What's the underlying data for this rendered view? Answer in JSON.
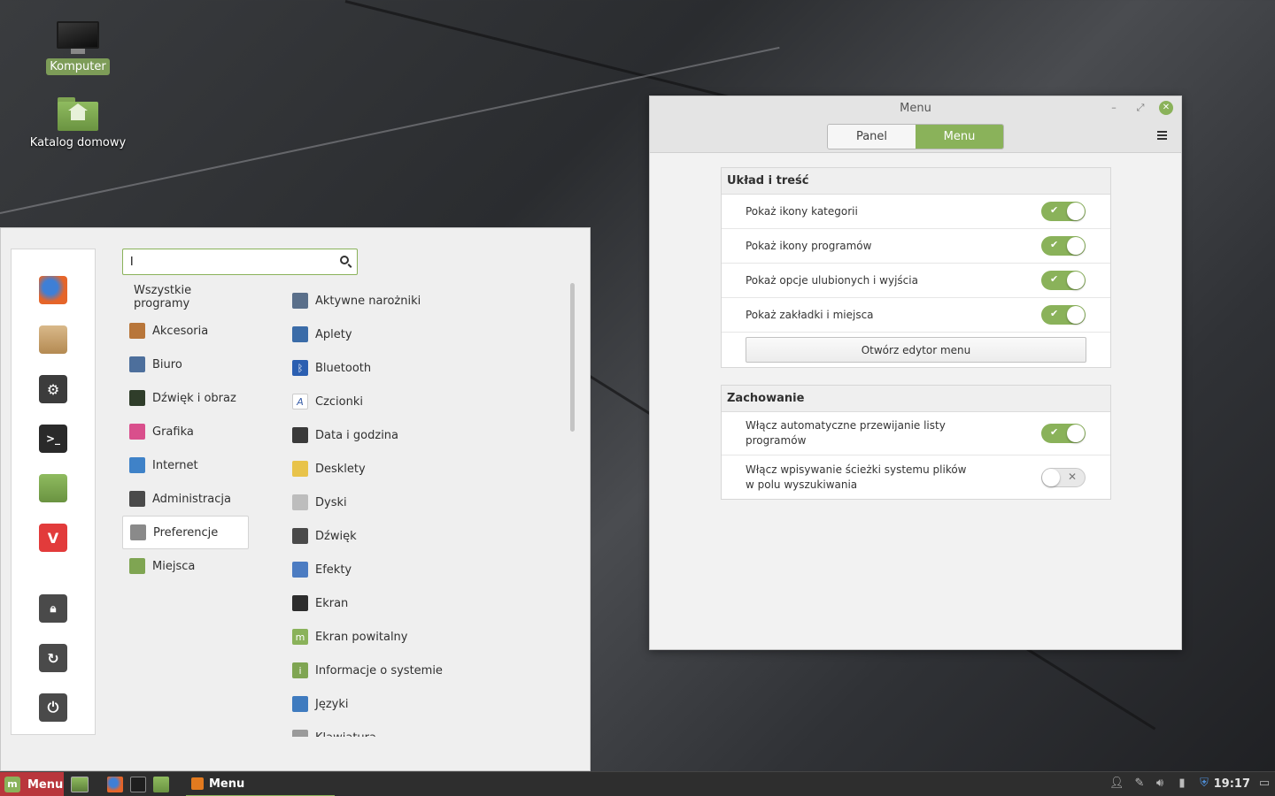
{
  "desktop": {
    "icons": [
      {
        "label": "Komputer",
        "icon": "computer-icon",
        "selected": true
      },
      {
        "label": "Katalog domowy",
        "icon": "home-folder-icon",
        "selected": false
      }
    ]
  },
  "start_menu": {
    "search": {
      "value": "l",
      "placeholder": ""
    },
    "favorites": [
      "firefox-icon",
      "software-manager-icon",
      "system-settings-icon",
      "terminal-icon",
      "files-icon",
      "vivaldi-icon"
    ],
    "session": [
      "lock-screen-icon",
      "logout-icon",
      "shutdown-icon"
    ],
    "categories": {
      "all": "Wszystkie programy",
      "items": [
        {
          "label": "Akcesoria",
          "color": "#b8763a"
        },
        {
          "label": "Biuro",
          "color": "#4d6f9c"
        },
        {
          "label": "Dźwięk i obraz",
          "color": "#2f3d2a"
        },
        {
          "label": "Grafika",
          "color": "#d94f8c"
        },
        {
          "label": "Internet",
          "color": "#3f82c8"
        },
        {
          "label": "Administracja",
          "color": "#4a4a4a"
        },
        {
          "label": "Preferencje",
          "color": "#8a8a8a"
        },
        {
          "label": "Miejsca",
          "color": "#7fa552"
        }
      ],
      "active": "Preferencje"
    },
    "apps": [
      {
        "label": "Aktywne narożniki",
        "color": "#5a6f8a",
        "glyph": ""
      },
      {
        "label": "Aplety",
        "color": "#3b6ca8",
        "glyph": ""
      },
      {
        "label": "Bluetooth",
        "color": "#2b5fb1",
        "glyph": "ᛒ"
      },
      {
        "label": "Czcionki",
        "color": "#ffffff",
        "glyph": "A"
      },
      {
        "label": "Data i godzina",
        "color": "#3a3a3a",
        "glyph": ""
      },
      {
        "label": "Desklety",
        "color": "#e8c34a",
        "glyph": ""
      },
      {
        "label": "Dyski",
        "color": "#bdbdbd",
        "glyph": ""
      },
      {
        "label": "Dźwięk",
        "color": "#4a4a4a",
        "glyph": ""
      },
      {
        "label": "Efekty",
        "color": "#4c7cc2",
        "glyph": ""
      },
      {
        "label": "Ekran",
        "color": "#2d2d2d",
        "glyph": ""
      },
      {
        "label": "Ekran powitalny",
        "color": "#8ab25a",
        "glyph": "m"
      },
      {
        "label": "Informacje o systemie",
        "color": "#7fa552",
        "glyph": "i"
      },
      {
        "label": "Języki",
        "color": "#3f7bbf",
        "glyph": ""
      },
      {
        "label": "Klawiatura",
        "color": "#9a9a9a",
        "glyph": ""
      }
    ]
  },
  "settings_window": {
    "title": "Menu",
    "controls": {
      "minimize": "–",
      "maximize": "⤢",
      "close": "✕"
    },
    "tabs": [
      {
        "label": "Panel",
        "active": false
      },
      {
        "label": "Menu",
        "active": true
      }
    ],
    "sections": [
      {
        "title": "Układ i treść",
        "rows": [
          {
            "label": "Pokaż ikony kategorii",
            "on": true
          },
          {
            "label": "Pokaż ikony programów",
            "on": true
          },
          {
            "label": "Pokaż opcje ulubionych i wyjścia",
            "on": true
          },
          {
            "label": "Pokaż zakładki i miejsca",
            "on": true
          }
        ],
        "button": "Otwórz edytor menu"
      },
      {
        "title": "Zachowanie",
        "rows": [
          {
            "label": "Włącz automatyczne przewijanie listy programów",
            "on": true
          },
          {
            "label": "Włącz wpisywanie ścieżki systemu plików w polu wyszukiwania",
            "on": false
          }
        ]
      }
    ],
    "accent": "#8ab25a"
  },
  "taskbar": {
    "menu_label": "Menu",
    "launchers": [
      "show-desktop-icon",
      "firefox-icon",
      "terminal-icon",
      "files-icon"
    ],
    "window_label": "Menu",
    "tray": [
      "user-icon",
      "network-icon",
      "volume-icon",
      "battery-icon",
      "shield-icon"
    ],
    "clock": "19:17"
  }
}
